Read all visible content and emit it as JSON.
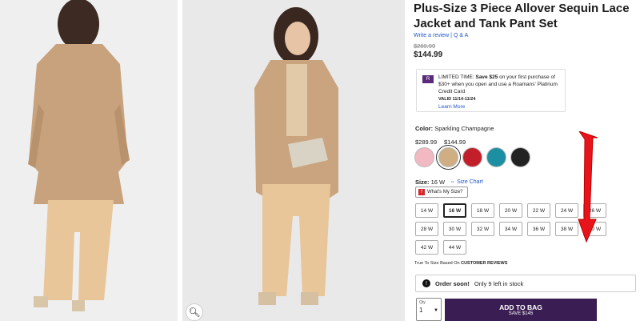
{
  "product": {
    "title": "Plus-Size 3 Piece Allover Sequin Lace Jacket and Tank Pant Set",
    "write_review": "Write a review",
    "separator": "|",
    "qa": "Q & A",
    "was_price": "$289.99",
    "now_price": "$144.99"
  },
  "promo": {
    "line1_prefix": "LIMITED TIME:",
    "line1_bold": "Save $25",
    "line1_rest": "on your first purchase of $30+ when you open and use a Roamans' Platinum Credit Card",
    "valid": "VALID 11/14-11/24",
    "learn_more": "Learn More"
  },
  "color": {
    "label": "Color:",
    "value": "Sparkling Champagne",
    "price_a": "$289.99",
    "price_b": "$144.99",
    "swatches": [
      "#f3b8c3",
      "#ccae85",
      "#c3202b",
      "#1f91a4",
      "#222222"
    ]
  },
  "size": {
    "label": "Size:",
    "value": "16 W",
    "chart": "Size Chart",
    "fit": "What's My Size?",
    "options": [
      "14 W",
      "16 W",
      "18 W",
      "20 W",
      "22 W",
      "24 W",
      "26 W",
      "28 W",
      "30 W",
      "32 W",
      "34 W",
      "36 W",
      "38 W",
      "40 W",
      "42 W",
      "44 W"
    ],
    "true_to_size": "True To Size Based On",
    "reviews": "CUSTOMER REVIEWS"
  },
  "stock": {
    "bold": "Order soon!",
    "text": "Only 9 left in stock"
  },
  "cart": {
    "qty_label": "Qty",
    "qty_value": "1",
    "add": "ADD TO BAG",
    "save": "SAVE $145"
  }
}
